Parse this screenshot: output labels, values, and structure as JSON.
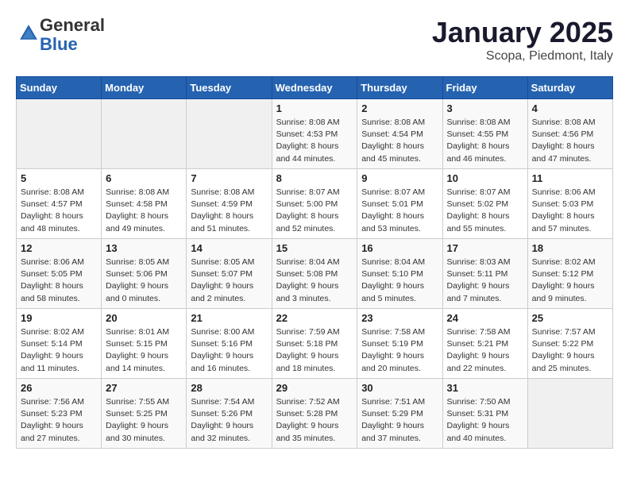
{
  "header": {
    "logo_general": "General",
    "logo_blue": "Blue",
    "title": "January 2025",
    "subtitle": "Scopa, Piedmont, Italy"
  },
  "weekdays": [
    "Sunday",
    "Monday",
    "Tuesday",
    "Wednesday",
    "Thursday",
    "Friday",
    "Saturday"
  ],
  "weeks": [
    [
      {
        "day": "",
        "info": ""
      },
      {
        "day": "",
        "info": ""
      },
      {
        "day": "",
        "info": ""
      },
      {
        "day": "1",
        "info": "Sunrise: 8:08 AM\nSunset: 4:53 PM\nDaylight: 8 hours\nand 44 minutes."
      },
      {
        "day": "2",
        "info": "Sunrise: 8:08 AM\nSunset: 4:54 PM\nDaylight: 8 hours\nand 45 minutes."
      },
      {
        "day": "3",
        "info": "Sunrise: 8:08 AM\nSunset: 4:55 PM\nDaylight: 8 hours\nand 46 minutes."
      },
      {
        "day": "4",
        "info": "Sunrise: 8:08 AM\nSunset: 4:56 PM\nDaylight: 8 hours\nand 47 minutes."
      }
    ],
    [
      {
        "day": "5",
        "info": "Sunrise: 8:08 AM\nSunset: 4:57 PM\nDaylight: 8 hours\nand 48 minutes."
      },
      {
        "day": "6",
        "info": "Sunrise: 8:08 AM\nSunset: 4:58 PM\nDaylight: 8 hours\nand 49 minutes."
      },
      {
        "day": "7",
        "info": "Sunrise: 8:08 AM\nSunset: 4:59 PM\nDaylight: 8 hours\nand 51 minutes."
      },
      {
        "day": "8",
        "info": "Sunrise: 8:07 AM\nSunset: 5:00 PM\nDaylight: 8 hours\nand 52 minutes."
      },
      {
        "day": "9",
        "info": "Sunrise: 8:07 AM\nSunset: 5:01 PM\nDaylight: 8 hours\nand 53 minutes."
      },
      {
        "day": "10",
        "info": "Sunrise: 8:07 AM\nSunset: 5:02 PM\nDaylight: 8 hours\nand 55 minutes."
      },
      {
        "day": "11",
        "info": "Sunrise: 8:06 AM\nSunset: 5:03 PM\nDaylight: 8 hours\nand 57 minutes."
      }
    ],
    [
      {
        "day": "12",
        "info": "Sunrise: 8:06 AM\nSunset: 5:05 PM\nDaylight: 8 hours\nand 58 minutes."
      },
      {
        "day": "13",
        "info": "Sunrise: 8:05 AM\nSunset: 5:06 PM\nDaylight: 9 hours\nand 0 minutes."
      },
      {
        "day": "14",
        "info": "Sunrise: 8:05 AM\nSunset: 5:07 PM\nDaylight: 9 hours\nand 2 minutes."
      },
      {
        "day": "15",
        "info": "Sunrise: 8:04 AM\nSunset: 5:08 PM\nDaylight: 9 hours\nand 3 minutes."
      },
      {
        "day": "16",
        "info": "Sunrise: 8:04 AM\nSunset: 5:10 PM\nDaylight: 9 hours\nand 5 minutes."
      },
      {
        "day": "17",
        "info": "Sunrise: 8:03 AM\nSunset: 5:11 PM\nDaylight: 9 hours\nand 7 minutes."
      },
      {
        "day": "18",
        "info": "Sunrise: 8:02 AM\nSunset: 5:12 PM\nDaylight: 9 hours\nand 9 minutes."
      }
    ],
    [
      {
        "day": "19",
        "info": "Sunrise: 8:02 AM\nSunset: 5:14 PM\nDaylight: 9 hours\nand 11 minutes."
      },
      {
        "day": "20",
        "info": "Sunrise: 8:01 AM\nSunset: 5:15 PM\nDaylight: 9 hours\nand 14 minutes."
      },
      {
        "day": "21",
        "info": "Sunrise: 8:00 AM\nSunset: 5:16 PM\nDaylight: 9 hours\nand 16 minutes."
      },
      {
        "day": "22",
        "info": "Sunrise: 7:59 AM\nSunset: 5:18 PM\nDaylight: 9 hours\nand 18 minutes."
      },
      {
        "day": "23",
        "info": "Sunrise: 7:58 AM\nSunset: 5:19 PM\nDaylight: 9 hours\nand 20 minutes."
      },
      {
        "day": "24",
        "info": "Sunrise: 7:58 AM\nSunset: 5:21 PM\nDaylight: 9 hours\nand 22 minutes."
      },
      {
        "day": "25",
        "info": "Sunrise: 7:57 AM\nSunset: 5:22 PM\nDaylight: 9 hours\nand 25 minutes."
      }
    ],
    [
      {
        "day": "26",
        "info": "Sunrise: 7:56 AM\nSunset: 5:23 PM\nDaylight: 9 hours\nand 27 minutes."
      },
      {
        "day": "27",
        "info": "Sunrise: 7:55 AM\nSunset: 5:25 PM\nDaylight: 9 hours\nand 30 minutes."
      },
      {
        "day": "28",
        "info": "Sunrise: 7:54 AM\nSunset: 5:26 PM\nDaylight: 9 hours\nand 32 minutes."
      },
      {
        "day": "29",
        "info": "Sunrise: 7:52 AM\nSunset: 5:28 PM\nDaylight: 9 hours\nand 35 minutes."
      },
      {
        "day": "30",
        "info": "Sunrise: 7:51 AM\nSunset: 5:29 PM\nDaylight: 9 hours\nand 37 minutes."
      },
      {
        "day": "31",
        "info": "Sunrise: 7:50 AM\nSunset: 5:31 PM\nDaylight: 9 hours\nand 40 minutes."
      },
      {
        "day": "",
        "info": ""
      }
    ]
  ]
}
